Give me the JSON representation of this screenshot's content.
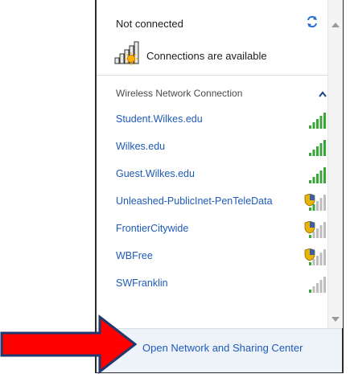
{
  "status": {
    "title": "Not connected",
    "connections_label": "Connections are available",
    "refresh_icon": "refresh-icon",
    "connections_icon": "network-bars-sun-icon"
  },
  "wireless": {
    "section_label": "Wireless Network Connection",
    "chevron_icon": "chevron-up-icon",
    "networks": [
      {
        "name": "Student.Wilkes.edu",
        "secured": false,
        "signal_bars": 5
      },
      {
        "name": "Wilkes.edu",
        "secured": false,
        "signal_bars": 5
      },
      {
        "name": "Guest.Wilkes.edu",
        "secured": false,
        "signal_bars": 5
      },
      {
        "name": "Unleashed-PublicInet-PenTeleData",
        "secured": true,
        "signal_bars": 2
      },
      {
        "name": "FrontierCitywide",
        "secured": true,
        "signal_bars": 1
      },
      {
        "name": "WBFree",
        "secured": true,
        "signal_bars": 1
      },
      {
        "name": "SWFranklin",
        "secured": false,
        "signal_bars": 1
      }
    ]
  },
  "footer": {
    "link_label": "Open Network and Sharing Center"
  },
  "colors": {
    "link": "#1e5ab8",
    "signal_active": "#3aa63a",
    "signal_inactive": "#bdbdbd",
    "arrow_fill": "#ff0000",
    "arrow_stroke": "#1f3a6e"
  }
}
